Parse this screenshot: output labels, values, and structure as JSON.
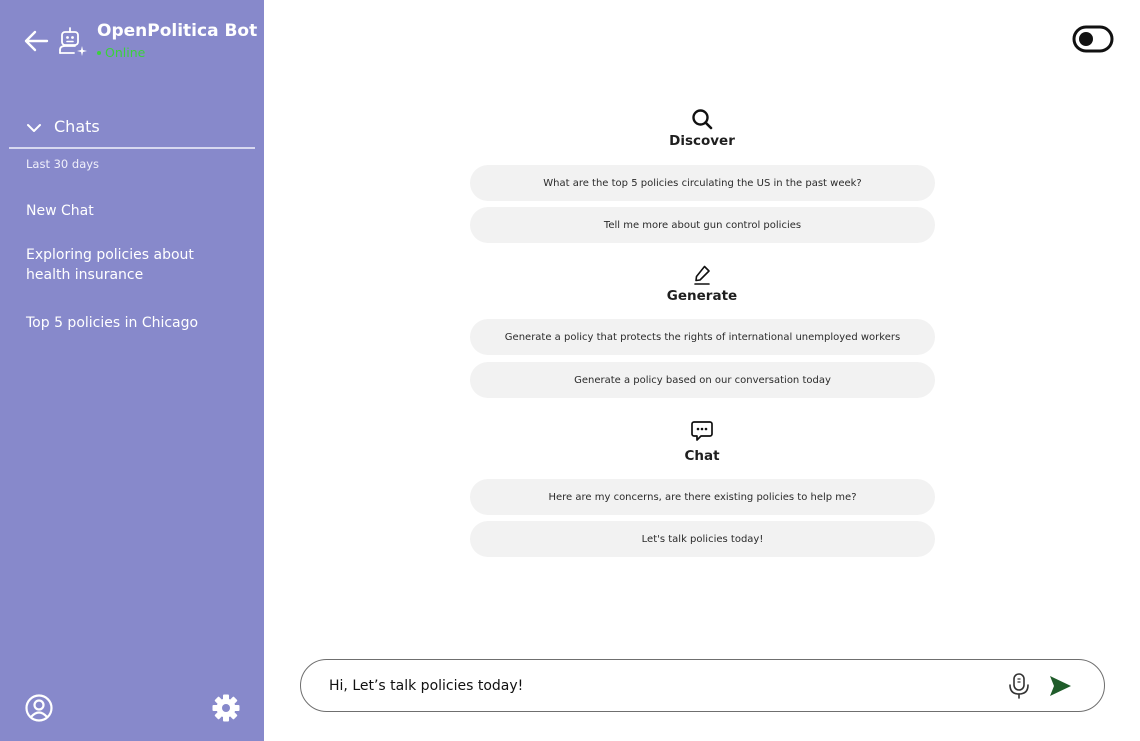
{
  "sidebar": {
    "bot_name": "OpenPolitica Bot",
    "bot_status": "Online",
    "chats_label": "Chats",
    "period_label": "Last 30 days",
    "chat_items": [
      {
        "label": "New Chat"
      },
      {
        "label": "Exploring policies about health insurance"
      },
      {
        "label": "Top 5 policies in Chicago"
      }
    ]
  },
  "sections": {
    "discover": {
      "icon": "search-icon",
      "title": "Discover",
      "suggestions": [
        "What are the top 5 policies circulating the US in the past week?",
        "Tell me more about gun control policies"
      ]
    },
    "generate": {
      "icon": "pencil-icon",
      "title": "Generate",
      "suggestions": [
        "Generate a policy that protects the rights of international unemployed workers",
        "Generate a policy based on our conversation today"
      ]
    },
    "chat": {
      "icon": "chat-bubble-icon",
      "title": "Chat",
      "suggestions": [
        "Here are my concerns, are there existing policies to help me?",
        "Let's talk policies today!"
      ]
    }
  },
  "composer": {
    "value": "Hi, Let’s talk policies today!"
  },
  "colors": {
    "sidebar_bg": "#8789cb",
    "status_online": "#3bd13b",
    "pill_bg": "#f2f2f2",
    "send_icon": "#1f5c2a"
  }
}
